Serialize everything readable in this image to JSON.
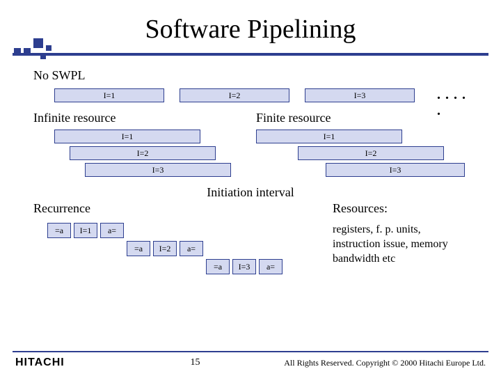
{
  "title": "Software Pipelining",
  "noswpl": {
    "label": "No SWPL",
    "bars": [
      "I=1",
      "I=2",
      "I=3"
    ],
    "dots": ". . . . ."
  },
  "infinite": {
    "label": "Infinite resource",
    "bars": [
      "I=1",
      "I=2",
      "I=3"
    ]
  },
  "finite": {
    "label": "Finite resource",
    "bars": [
      "I=1",
      "I=2",
      "I=3"
    ]
  },
  "initiation_label": "Initiation interval",
  "recurrence": {
    "label": "Recurrence",
    "cells": {
      "r1": [
        "=a",
        "I=1",
        "a="
      ],
      "r2": [
        "=a",
        "I=2",
        "a="
      ],
      "r3": [
        "=a",
        "I=3",
        "a="
      ]
    }
  },
  "resources": {
    "label": "Resources:",
    "text": "registers, f. p. units, instruction issue, memory bandwidth etc"
  },
  "footer": {
    "brand": "HITACHI",
    "page": "15",
    "copyright": "All Rights Reserved. Copyright © 2000 Hitachi Europe Ltd."
  }
}
